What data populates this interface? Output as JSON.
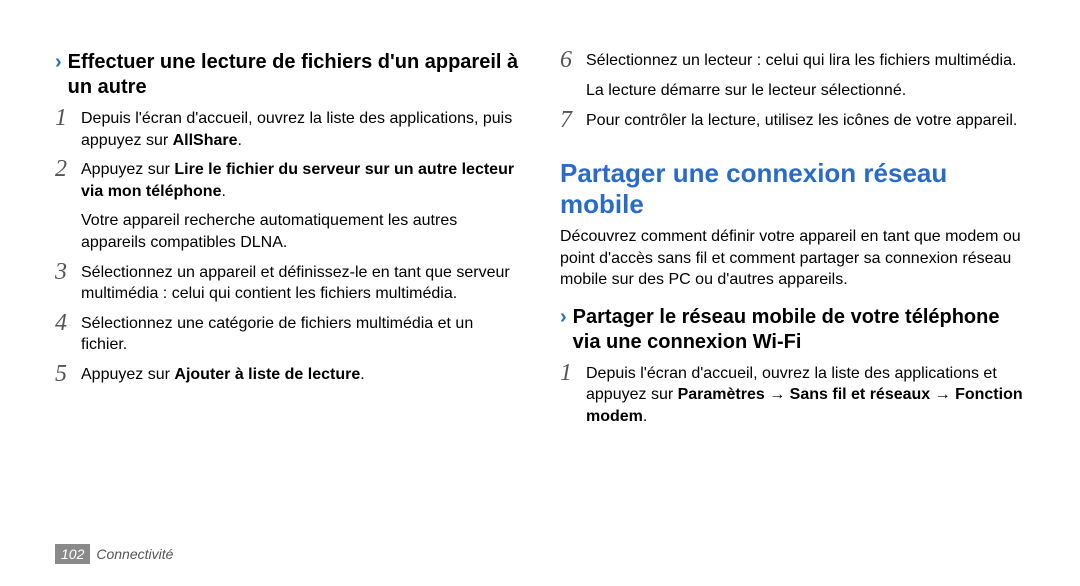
{
  "left": {
    "subheading": "Effectuer une lecture de fichiers d'un appareil à un autre",
    "steps": {
      "s1_a": "Depuis l'écran d'accueil, ouvrez la liste des applications, puis appuyez sur ",
      "s1_bold": "AllShare",
      "s1_b": ".",
      "s2_a": "Appuyez sur ",
      "s2_bold": "Lire le fichier du serveur sur un autre lecteur via mon téléphone",
      "s2_b": ".",
      "s2_after": "Votre appareil recherche automatiquement les autres appareils compatibles DLNA.",
      "s3": "Sélectionnez un appareil et définissez-le en tant que serveur multimédia : celui qui contient les fichiers multimédia.",
      "s4": "Sélectionnez une catégorie de fichiers multimédia et un fichier.",
      "s5_a": "Appuyez sur ",
      "s5_bold": "Ajouter à liste de lecture",
      "s5_b": "."
    }
  },
  "right": {
    "steps_top": {
      "s6": "Sélectionnez un lecteur : celui qui lira les fichiers multimédia.",
      "s6_after": "La lecture démarre sur le lecteur sélectionné.",
      "s7": "Pour contrôler la lecture, utilisez les icônes de votre appareil."
    },
    "section_title": "Partager une connexion réseau mobile",
    "intro": "Découvrez comment définir votre appareil en tant que modem ou point d'accès sans fil et comment partager sa connexion réseau mobile sur des PC ou d'autres appareils.",
    "subheading": "Partager le réseau mobile de votre téléphone via une connexion Wi-Fi",
    "steps_bottom": {
      "s1_a": "Depuis l'écran d'accueil, ouvrez la liste des applications et appuyez sur ",
      "s1_b1": "Paramètres",
      "s1_arr": " → ",
      "s1_b2": "Sans fil et réseaux",
      "s1_b3": "Fonction modem",
      "s1_c": "."
    }
  },
  "footer": {
    "page": "102",
    "section": "Connectivité"
  },
  "num": {
    "n1": "1",
    "n2": "2",
    "n3": "3",
    "n4": "4",
    "n5": "5",
    "n6": "6",
    "n7": "7"
  },
  "chevron": "›"
}
